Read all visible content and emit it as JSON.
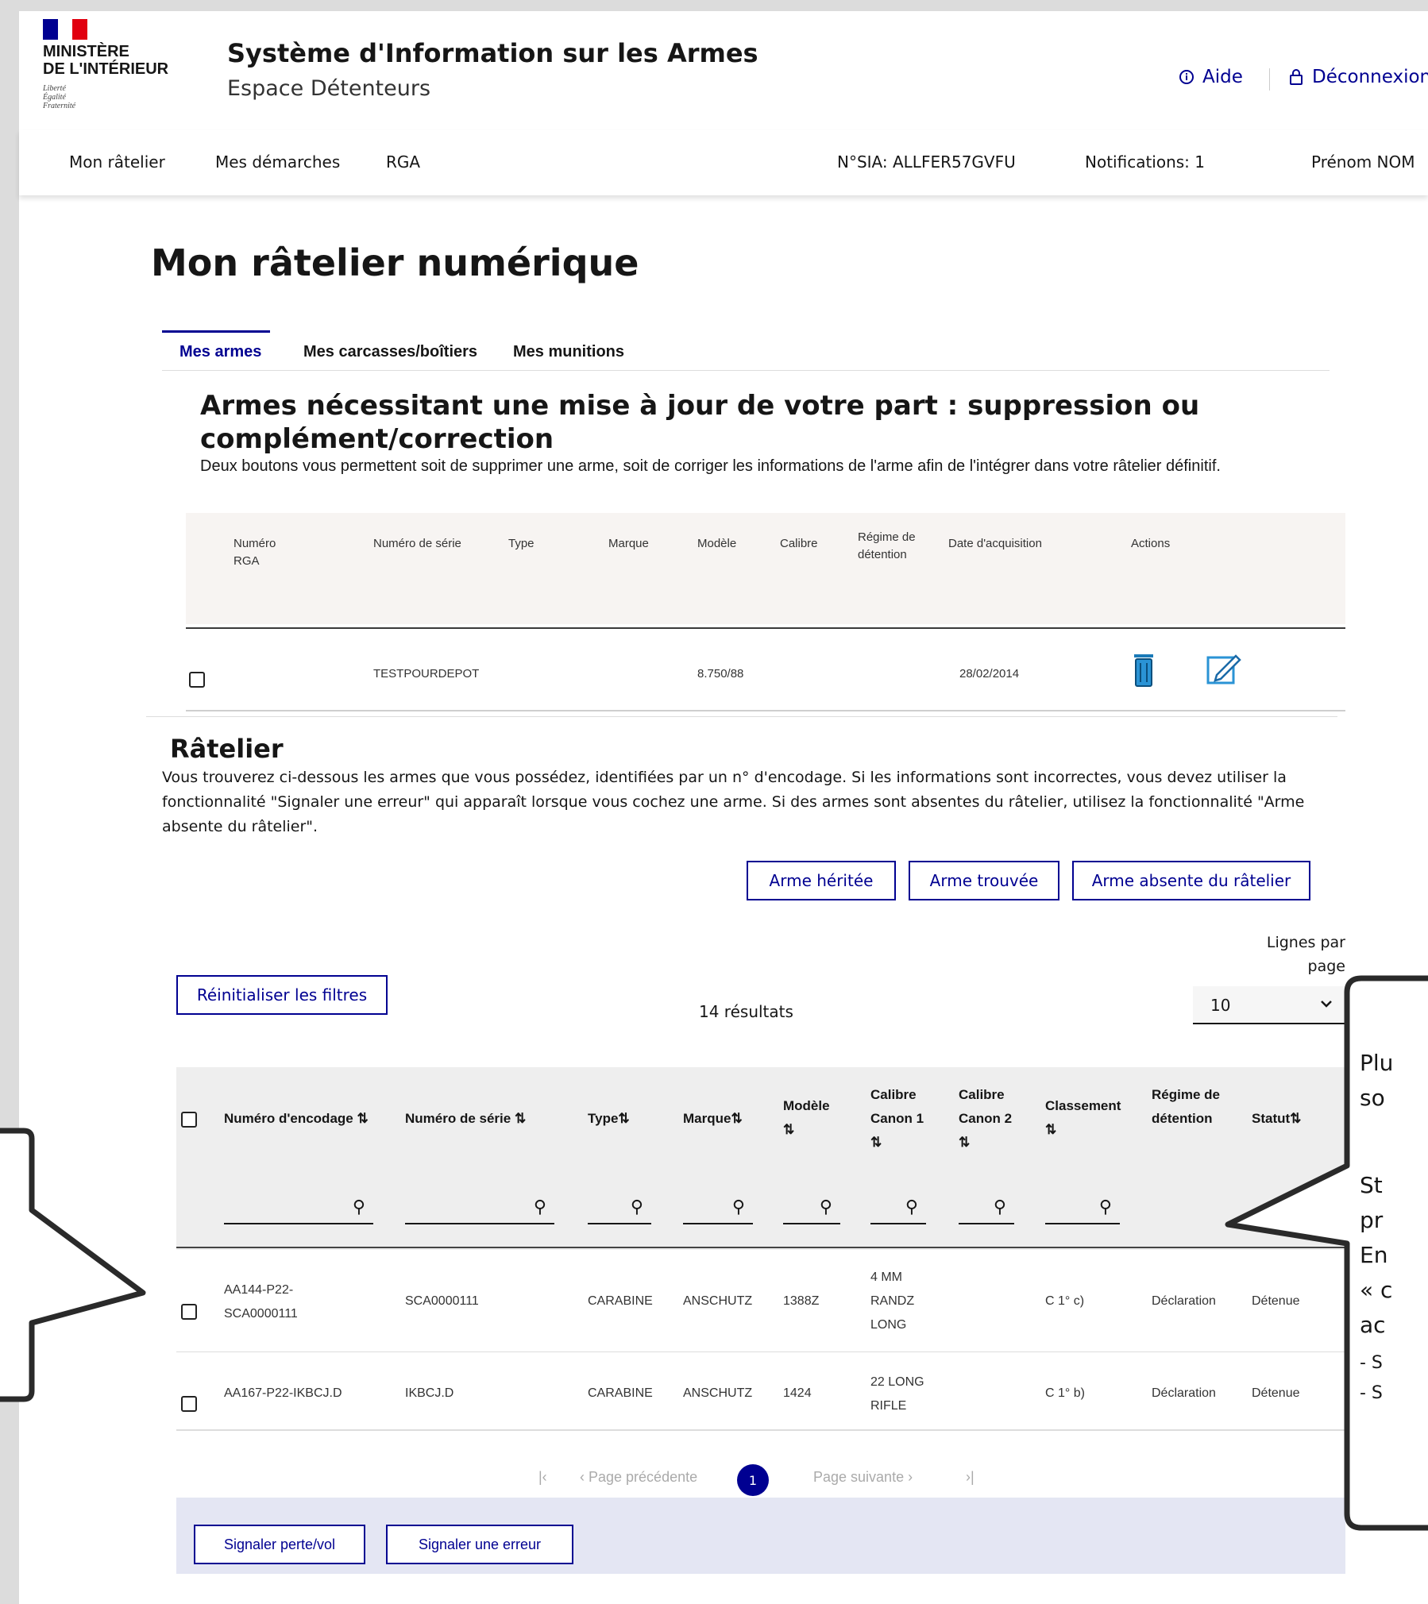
{
  "header": {
    "logo_lines": "MINISTÈRE\nDE L'INTÉRIEUR",
    "motto": "Liberté\nÉgalité\nFraternité",
    "site_title": "Système d'Information sur les Armes",
    "site_subtitle": "Espace Détenteurs",
    "help_label": "Aide",
    "logout_label": "Déconnexion"
  },
  "nav": {
    "items": [
      "Mon râtelier",
      "Mes démarches",
      "RGA"
    ],
    "sia_number": "N°SIA: ALLFER57GVFU",
    "notifications": "Notifications: 1",
    "user_name": "Prénom NOM"
  },
  "page_title": "Mon râtelier numérique",
  "tabs": [
    "Mes armes",
    "Mes carcasses/boîtiers",
    "Mes munitions"
  ],
  "update_section": {
    "title": "Armes nécessitant une mise à jour de votre part : suppression ou complément/correction",
    "lead": "Deux boutons vous permettent soit de supprimer une arme, soit de corriger les informations de l'arme afin de l'intégrer dans votre râtelier définitif.",
    "columns": [
      "Numéro RGA",
      "Numéro de série",
      "Type",
      "Marque",
      "Modèle",
      "Calibre",
      "Régime de détention",
      "Date d'acquisition",
      "Actions"
    ],
    "row": {
      "serial": "TESTPOURDEPOT",
      "model": "8.750/88",
      "date": "28/02/2014"
    }
  },
  "ratelier": {
    "title": "Râtelier",
    "description": "Vous trouverez ci-dessous les armes que vous possédez, identifiées par un n° d'encodage. Si les informations sont incorrectes, vous devez utiliser la fonctionnalité \"Signaler une erreur\" qui apparaît lorsque vous cochez une arme. Si des armes sont absentes du râtelier, utilisez la fonctionnalité \"Arme absente du râtelier\".",
    "buttons": {
      "inherited": "Arme héritée",
      "found": "Arme trouvée",
      "absent": "Arme absente du râtelier"
    },
    "reset_filters": "Réinitialiser les filtres",
    "results": "14 résultats",
    "lines_per_page_label": "Lignes par page",
    "lines_per_page_value": "10",
    "columns": {
      "encodage": "Numéro d'encodage ⇅",
      "serie": "Numéro de série ⇅",
      "type": "Type⇅",
      "marque": "Marque⇅",
      "modele": "Modèle ⇅",
      "calibre1": "Calibre Canon 1 ⇅",
      "calibre2": "Calibre Canon 2 ⇅",
      "classement": "Classement ⇅",
      "regime": "Régime de détention",
      "statut": "Statut⇅"
    },
    "rows": [
      {
        "encodage": "AA144-P22-SCA0000111",
        "serie": "SCA0000111",
        "type": "CARABINE",
        "marque": "ANSCHUTZ",
        "modele": "1388Z",
        "calibre1": "4 MM RANDZ LONG",
        "calibre2": "",
        "classement": "C 1° c)",
        "regime": "Déclaration",
        "statut": "Détenue"
      },
      {
        "encodage": "AA167-P22-IKBCJ.D",
        "serie": "IKBCJ.D",
        "type": "CARABINE",
        "marque": "ANSCHUTZ",
        "modele": "1424",
        "calibre1": "22 LONG RIFLE",
        "calibre2": "",
        "classement": "C 1° b)",
        "regime": "Déclaration",
        "statut": "Détenue"
      }
    ],
    "pagination": {
      "prev": "Page précédente",
      "current": "1",
      "next": "Page suivante"
    },
    "actions": {
      "loss": "Signaler perte/vol",
      "error": "Signaler une erreur"
    }
  },
  "callout_right": {
    "l1": "Plu",
    "l2": "so",
    "l3": "St",
    "l4": "pr",
    "l5": "En",
    "l6": "« c",
    "l7": "ac",
    "l8": "- S",
    "l9": "- S"
  },
  "colors": {
    "accent": "#000091",
    "flag_red": "#e1000f"
  }
}
